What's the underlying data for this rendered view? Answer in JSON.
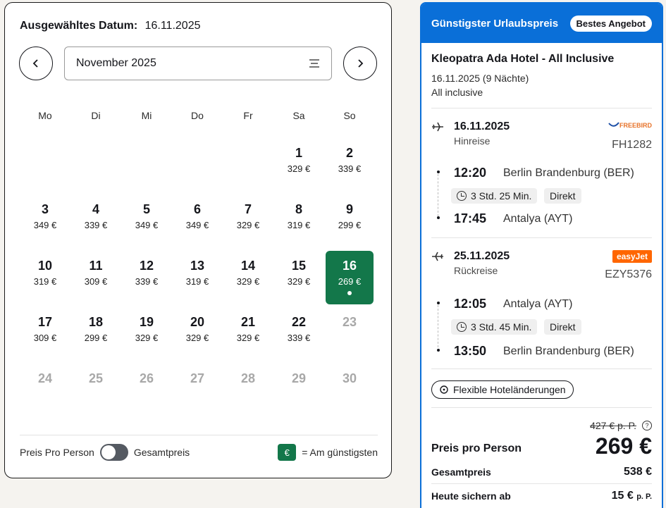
{
  "calendar": {
    "selected_label": "Ausgewähltes Datum:",
    "selected_value": "16.11.2025",
    "month": "November 2025",
    "prev_icon": "chevron-left-icon",
    "next_icon": "chevron-right-icon",
    "weekdays": [
      "Mo",
      "Di",
      "Mi",
      "Do",
      "Fr",
      "Sa",
      "So"
    ],
    "leading_blanks": 5,
    "days": [
      {
        "day": "1",
        "price": "329 €"
      },
      {
        "day": "2",
        "price": "339 €"
      },
      {
        "day": "3",
        "price": "349 €"
      },
      {
        "day": "4",
        "price": "339 €"
      },
      {
        "day": "5",
        "price": "349 €"
      },
      {
        "day": "6",
        "price": "349 €"
      },
      {
        "day": "7",
        "price": "329 €"
      },
      {
        "day": "8",
        "price": "319 €"
      },
      {
        "day": "9",
        "price": "299 €"
      },
      {
        "day": "10",
        "price": "319 €"
      },
      {
        "day": "11",
        "price": "309 €"
      },
      {
        "day": "12",
        "price": "339 €"
      },
      {
        "day": "13",
        "price": "319 €"
      },
      {
        "day": "14",
        "price": "329 €"
      },
      {
        "day": "15",
        "price": "329 €"
      },
      {
        "day": "16",
        "price": "269 €",
        "selected": true
      },
      {
        "day": "17",
        "price": "309 €"
      },
      {
        "day": "18",
        "price": "299 €"
      },
      {
        "day": "19",
        "price": "329 €"
      },
      {
        "day": "20",
        "price": "329 €"
      },
      {
        "day": "21",
        "price": "329 €"
      },
      {
        "day": "22",
        "price": "339 €"
      },
      {
        "day": "23",
        "disabled": true
      },
      {
        "day": "24",
        "disabled": true
      },
      {
        "day": "25",
        "disabled": true
      },
      {
        "day": "26",
        "disabled": true
      },
      {
        "day": "27",
        "disabled": true
      },
      {
        "day": "28",
        "disabled": true
      },
      {
        "day": "29",
        "disabled": true
      },
      {
        "day": "30",
        "disabled": true
      }
    ],
    "footer": {
      "per_person": "Preis Pro Person",
      "total": "Gesamtpreis",
      "legend_badge": "€",
      "legend_text": "= Am günstigsten"
    },
    "selected_color": "#13774a"
  },
  "offer": {
    "header": "Günstigster Urlaubspreis",
    "badge": "Bestes Angebot",
    "hotel_name": "Kleopatra Ada Hotel - All Inclusive",
    "hotel_dates": "16.11.2025 (9 Nächte)",
    "board": "All inclusive",
    "outbound": {
      "date": "16.11.2025",
      "kind": "Hinreise",
      "airline": "FREEBIRD",
      "flight_no": "FH1282",
      "dep_time": "12:20",
      "dep_airport": "Berlin Brandenburg (BER)",
      "duration": "3 Std. 25 Min.",
      "type": "Direkt",
      "arr_time": "17:45",
      "arr_airport": "Antalya (AYT)"
    },
    "return": {
      "date": "25.11.2025",
      "kind": "Rückreise",
      "airline": "easyJet",
      "flight_no": "EZY5376",
      "dep_time": "12:05",
      "dep_airport": "Antalya (AYT)",
      "duration": "3 Std. 45 Min.",
      "type": "Direkt",
      "arr_time": "13:50",
      "arr_airport": "Berlin Brandenburg (BER)"
    },
    "flex_button": "Flexible Hoteländerungen",
    "old_price": "427 € p. P.",
    "price_label": "Preis pro Person",
    "price": "269 €",
    "total_label": "Gesamtpreis",
    "total": "538 €",
    "deposit_label": "Heute sichern ab",
    "deposit": "15 €",
    "deposit_unit": "p. P.",
    "accent_color": "#0a6fd8"
  }
}
